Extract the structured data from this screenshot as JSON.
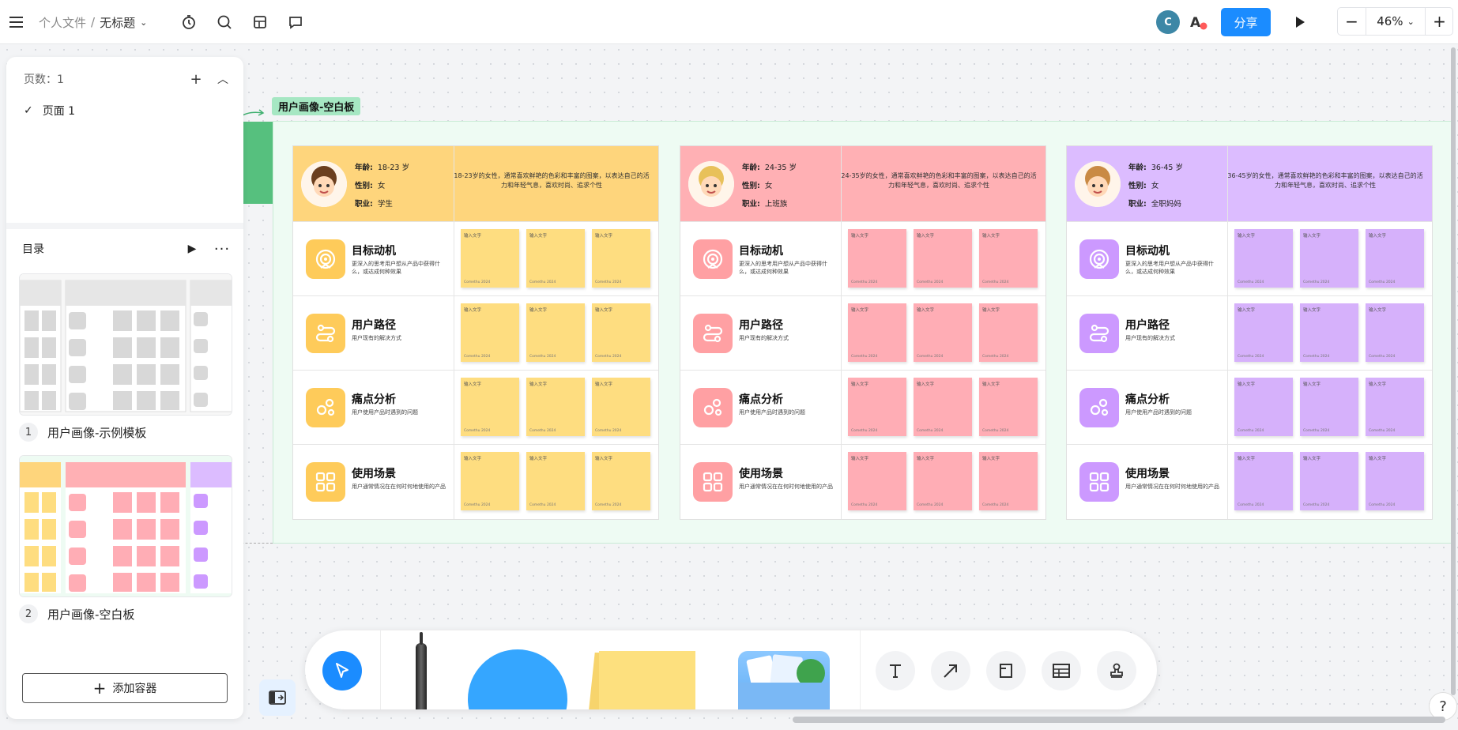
{
  "topbar": {
    "crumb_root": "个人文件",
    "crumb_sep": "/",
    "crumb_current": "无标题",
    "avatar_initial": "C",
    "share_label": "分享",
    "zoom_value": "46%",
    "zoom_minus": "−",
    "zoom_plus": "+"
  },
  "pages_panel": {
    "page_count_label": "页数：1",
    "pages": [
      {
        "label": "页面 1",
        "selected": true
      }
    ],
    "toc_label": "目录",
    "toc_items": [
      {
        "num": "1",
        "label": "用户画像-示例模板"
      },
      {
        "num": "2",
        "label": "用户画像-空白板"
      }
    ],
    "add_container_label": "添加容器"
  },
  "canvas": {
    "frame_title": "用户画像-空白板",
    "row_titles": [
      "目标动机",
      "用户路径",
      "痛点分析",
      "使用场景"
    ],
    "row_subs": [
      "更深入的思考用户想从产品中获得什么，或达成何种效果",
      "用户现有的解决方式",
      "用户使用产品时遇到的问题",
      "用户通常情况在在何时何地使用的产品"
    ],
    "note_text": "输入文字",
    "note_author": "Comethu 2024",
    "personas": [
      {
        "color": "#fedd80",
        "header_bg": "#fed57c",
        "icon_bg": "#fecb5a",
        "note_bg": "#fedd80",
        "age_label": "年龄:",
        "age": "18-23 岁",
        "gender_label": "性别:",
        "gender": "女",
        "job_label": "职业:",
        "job": "学生",
        "desc": "18-23岁的女性，通常喜欢鲜艳的色彩和丰富的图案，以表达自己的活力和年轻气息，喜欢时尚、追求个性"
      },
      {
        "color": "#ffadb5",
        "header_bg": "#ffb0b4",
        "icon_bg": "#ffa0a3",
        "note_bg": "#ffadb5",
        "age_label": "年龄:",
        "age": "24-35 岁",
        "gender_label": "性别:",
        "gender": "女",
        "job_label": "职业:",
        "job": "上班族",
        "desc": "24-35岁的女性，通常喜欢鲜艳的色彩和丰富的图案，以表达自己的活力和年轻气息，喜欢时尚、追求个性"
      },
      {
        "color": "#d9b3ff",
        "header_bg": "#dcbcff",
        "icon_bg": "#cc99ff",
        "note_bg": "#d6b1fb",
        "age_label": "年龄:",
        "age": "36-45 岁",
        "gender_label": "性别:",
        "gender": "女",
        "job_label": "职业:",
        "job": "全职妈妈",
        "desc": "36-45岁的女性，通常喜欢鲜艳的色彩和丰富的图案，以表达自己的活力和年轻气息，喜欢时尚、追求个性"
      }
    ]
  },
  "icons": [
    "menu-icon",
    "timer-icon",
    "search-icon",
    "template-icon",
    "comment-icon",
    "ai-icon",
    "play-icon",
    "check-icon",
    "plus-icon",
    "collapse-icon",
    "more-icon",
    "pointer-icon",
    "text-icon",
    "arrow-icon",
    "frame-icon",
    "table-icon",
    "stamp-icon",
    "panel-toggle-icon",
    "help-icon"
  ],
  "help_label": "?"
}
